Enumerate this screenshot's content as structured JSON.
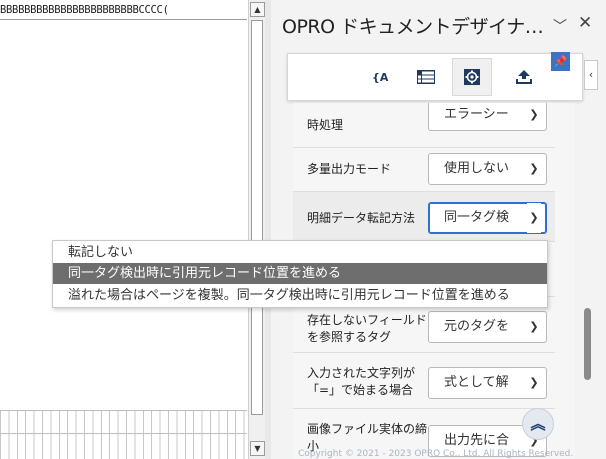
{
  "document": {
    "top_text": "BBBBBBBBBBBBBBBBBBBBBBBCCCC("
  },
  "pane": {
    "title": "OPRO ドキュメントデザイナ…",
    "menu_icon": "chevron-down",
    "close_icon": "x"
  },
  "toolbar": {
    "buttons": [
      {
        "label": "{A}",
        "icon": "field-icon"
      },
      {
        "label": "",
        "icon": "table-icon"
      },
      {
        "label": "",
        "icon": "gear-icon"
      },
      {
        "label": "",
        "icon": "upload-icon"
      }
    ],
    "active_index": 2
  },
  "settings": {
    "rows": [
      {
        "label": "時処理",
        "value": "エラーシー"
      },
      {
        "label": "多量出力モード",
        "value": "使用しない"
      },
      {
        "label": "明細データ転記方法",
        "value": "同一タグ検"
      },
      {
        "label": "存在しないフィールド\nを参照するタグ",
        "value": "元のタグを"
      },
      {
        "label": "入力された文字列が\n「=」で始まる場合",
        "value": "式として解"
      },
      {
        "label": "画像ファイル実体の締\n小",
        "value": "出力先に合"
      }
    ]
  },
  "dropdown": {
    "options": [
      "転記しない",
      "同一タグ検出時に引用元レコード位置を進める",
      "溢れた場合はページを複製。同一タグ検出時に引用元レコード位置を進める"
    ],
    "selected_index": 1
  },
  "footer": {
    "copyright": "Copyright © 2021 - 2023 OPRO Co., Ltd. All Rights Reserved."
  },
  "colors": {
    "accent": "#2f6fcf",
    "selected_option_bg": "#6e6e6e",
    "pin_bg": "#3b73c6"
  }
}
